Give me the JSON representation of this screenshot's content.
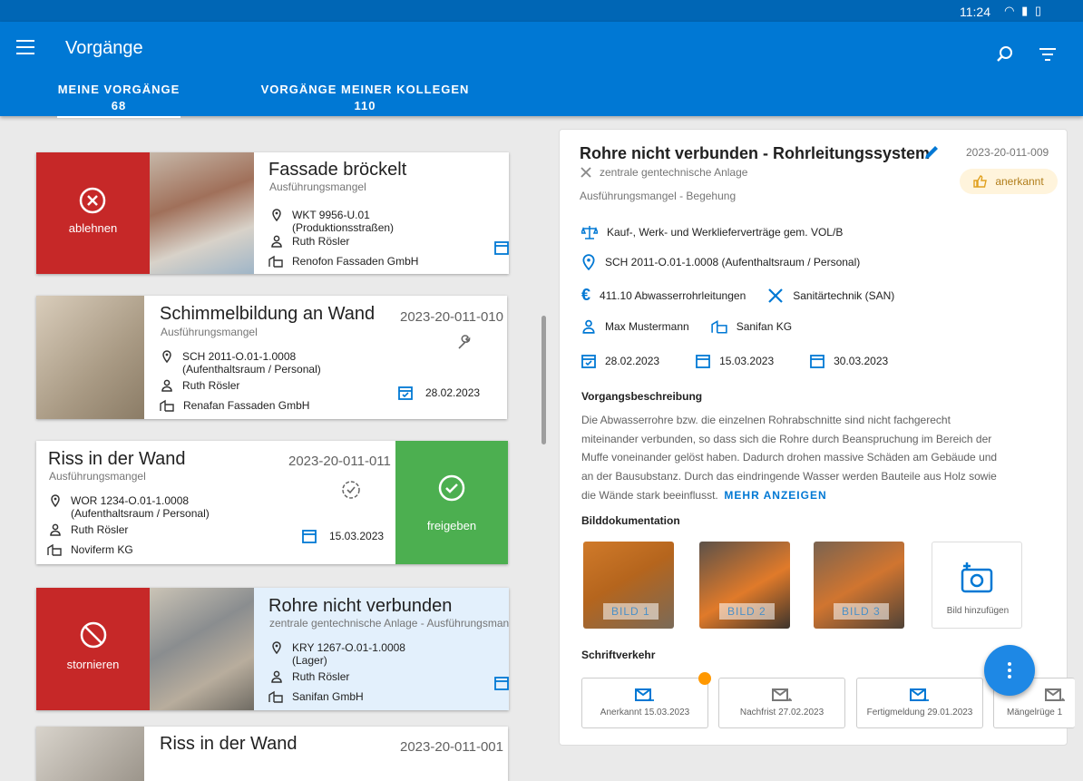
{
  "status": {
    "time": "11:24"
  },
  "app": {
    "title": "Vorgänge"
  },
  "tabs": [
    {
      "label": "MEINE VORGÄNGE",
      "count": "68"
    },
    {
      "label": "VORGÄNGE MEINER KOLLEGEN",
      "count": "110"
    }
  ],
  "cards": [
    {
      "title": "Fassade bröckelt",
      "sub": "Ausführungsmangel",
      "loc1": "WKT 9956-U.01",
      "loc2": "(Produktionsstraßen)",
      "person": "Ruth Rösler",
      "company": "Renofon Fassaden GmbH",
      "action": "ablehnen"
    },
    {
      "title": "Schimmelbildung an Wand",
      "sub": "Ausführungsmangel",
      "id": "2023-20-011-010",
      "loc1": "SCH 2011-O.01-1.0008",
      "loc2": "(Aufenthaltsraum / Personal)",
      "person": "Ruth Rösler",
      "company": "Renafan Fassaden GmbH",
      "date": "28.02.2023"
    },
    {
      "title": "Riss in der Wand",
      "sub": "Ausführungsmangel",
      "id": "2023-20-011-011",
      "loc1": "WOR 1234-O.01-1.0008",
      "loc2": "(Aufenthaltsraum / Personal)",
      "person": "Ruth Rösler",
      "company": "Noviferm KG",
      "date": "15.03.2023",
      "action": "freigeben"
    },
    {
      "title": "Rohre nicht verbunden",
      "sub": "zentrale gentechnische Anlage - Ausführungsman",
      "loc1": "KRY 1267-O.01-1.0008",
      "loc2": "(Lager)",
      "person": "Ruth Rösler",
      "company": "Sanifan GmbH",
      "action": "stornieren"
    },
    {
      "title": "Riss in der Wand",
      "id": "2023-20-011-001"
    }
  ],
  "detail": {
    "title": "Rohre nicht verbunden - Rohrleitungssystem",
    "id": "2023-20-011-009",
    "facility": "zentrale gentechnische Anlage",
    "status": "anerkannt",
    "type": "Ausführungsmangel - Begehung",
    "contract": "Kauf-, Werk- und Werklieferverträge gem. VOL/B",
    "location": "SCH 2011-O.01-1.0008 (Aufenthaltsraum / Personal)",
    "cost": "411.10 Abwasserrohrleitungen",
    "trade": "Sanitärtechnik (SAN)",
    "person": "Max Mustermann",
    "company": "Sanifan KG",
    "date1": "28.02.2023",
    "date2": "15.03.2023",
    "date3": "30.03.2023",
    "desc_heading": "Vorgangsbeschreibung",
    "desc_lines": [
      "Die Abwasserrohre bzw. die einzelnen Rohrabschnitte sind nicht fachgerecht",
      "miteinander verbunden, so dass sich die Rohre durch Beanspruchung im Bereich der",
      "Muffe voneinander gelöst haben. Dadurch drohen massive Schäden am Gebäude und",
      "an der Bausubstanz. Durch das eindringende Wasser werden Bauteile aus Holz sowie",
      "die Wände stark beeinflusst."
    ],
    "more": "MEHR ANZEIGEN",
    "img_heading": "Bilddokumentation",
    "images": [
      "BILD 1",
      "BILD 2",
      "BILD 3"
    ],
    "add_image": "Bild hinzufügen",
    "corr_heading": "Schriftverkehr",
    "correspondence": [
      "Anerkannt 15.03.2023",
      "Nachfrist 27.02.2023",
      "Fertigmeldung 29.01.2023",
      "Mängelrüge 1"
    ]
  },
  "colors": {
    "primary": "#0078d4",
    "reject": "#c62828",
    "approve": "#4caf50",
    "status_bg": "#fff4dc",
    "status_text": "#b07d1a"
  }
}
